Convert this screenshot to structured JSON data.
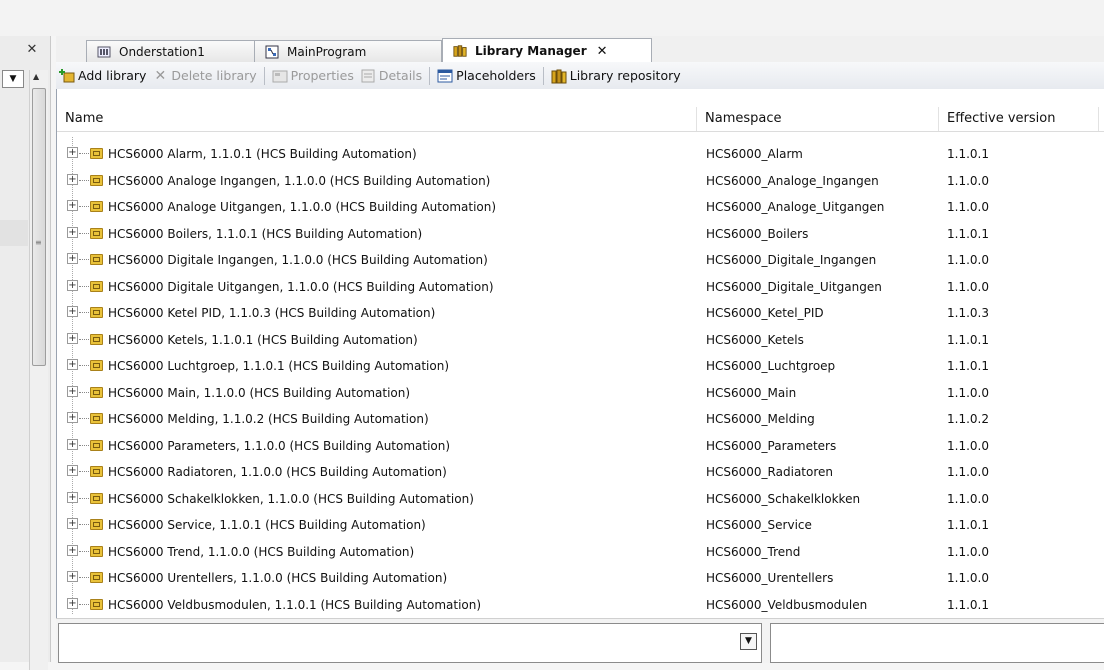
{
  "left_panel": {
    "close_glyph": "✕",
    "dropdown_glyph": "▼",
    "scroll_up_glyph": "▲",
    "scroll_grip_glyph": "≡"
  },
  "tabs": [
    {
      "label": "Onderstation1",
      "icon": "device-icon",
      "active": false
    },
    {
      "label": "MainProgram",
      "icon": "program-icon",
      "active": false
    },
    {
      "label": "Library Manager",
      "icon": "library-books-icon",
      "active": true,
      "close": "✕"
    }
  ],
  "toolbar": {
    "add_library": "Add library",
    "delete_library": "Delete library",
    "properties": "Properties",
    "details": "Details",
    "placeholders": "Placeholders",
    "library_repository": "Library repository"
  },
  "columns": {
    "name": "Name",
    "namespace": "Namespace",
    "effective_version": "Effective version"
  },
  "rows": [
    {
      "name": "HCS6000 Alarm, 1.1.0.1 (HCS Building Automation)",
      "namespace": "HCS6000_Alarm",
      "version": "1.1.0.1"
    },
    {
      "name": "HCS6000 Analoge Ingangen, 1.1.0.0 (HCS Building Automation)",
      "namespace": "HCS6000_Analoge_Ingangen",
      "version": "1.1.0.0"
    },
    {
      "name": "HCS6000 Analoge Uitgangen, 1.1.0.0 (HCS Building Automation)",
      "namespace": "HCS6000_Analoge_Uitgangen",
      "version": "1.1.0.0"
    },
    {
      "name": "HCS6000 Boilers, 1.1.0.1 (HCS Building Automation)",
      "namespace": "HCS6000_Boilers",
      "version": "1.1.0.1"
    },
    {
      "name": "HCS6000 Digitale Ingangen, 1.1.0.0 (HCS Building Automation)",
      "namespace": "HCS6000_Digitale_Ingangen",
      "version": "1.1.0.0"
    },
    {
      "name": "HCS6000 Digitale Uitgangen, 1.1.0.0 (HCS Building Automation)",
      "namespace": "HCS6000_Digitale_Uitgangen",
      "version": "1.1.0.0"
    },
    {
      "name": "HCS6000 Ketel PID, 1.1.0.3 (HCS Building Automation)",
      "namespace": "HCS6000_Ketel_PID",
      "version": "1.1.0.3"
    },
    {
      "name": "HCS6000 Ketels, 1.1.0.1 (HCS Building Automation)",
      "namespace": "HCS6000_Ketels",
      "version": "1.1.0.1"
    },
    {
      "name": "HCS6000 Luchtgroep, 1.1.0.1 (HCS Building Automation)",
      "namespace": "HCS6000_Luchtgroep",
      "version": "1.1.0.1"
    },
    {
      "name": "HCS6000 Main, 1.1.0.0 (HCS Building Automation)",
      "namespace": "HCS6000_Main",
      "version": "1.1.0.0"
    },
    {
      "name": "HCS6000 Melding, 1.1.0.2 (HCS Building Automation)",
      "namespace": "HCS6000_Melding",
      "version": "1.1.0.2"
    },
    {
      "name": "HCS6000 Parameters, 1.1.0.0 (HCS Building Automation)",
      "namespace": "HCS6000_Parameters",
      "version": "1.1.0.0"
    },
    {
      "name": "HCS6000 Radiatoren, 1.1.0.0 (HCS Building Automation)",
      "namespace": "HCS6000_Radiatoren",
      "version": "1.1.0.0"
    },
    {
      "name": "HCS6000 Schakelklokken, 1.1.0.0 (HCS Building Automation)",
      "namespace": "HCS6000_Schakelklokken",
      "version": "1.1.0.0"
    },
    {
      "name": "HCS6000 Service, 1.1.0.1 (HCS Building Automation)",
      "namespace": "HCS6000_Service",
      "version": "1.1.0.1"
    },
    {
      "name": "HCS6000 Trend, 1.1.0.0 (HCS Building Automation)",
      "namespace": "HCS6000_Trend",
      "version": "1.1.0.0"
    },
    {
      "name": "HCS6000 Urentellers, 1.1.0.0 (HCS Building Automation)",
      "namespace": "HCS6000_Urentellers",
      "version": "1.1.0.0"
    },
    {
      "name": "HCS6000 Veldbusmodulen, 1.1.0.1 (HCS Building Automation)",
      "namespace": "HCS6000_Veldbusmodulen",
      "version": "1.1.0.1"
    }
  ],
  "bottom": {
    "dropdown_glyph": "▼"
  },
  "colors": {
    "accent_tab_border": "#9aa3b0",
    "library_icon": "#e9c23a"
  }
}
